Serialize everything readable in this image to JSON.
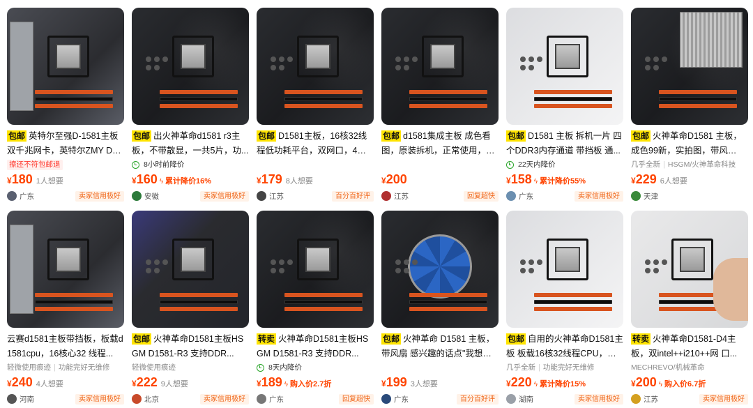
{
  "listings": [
    {
      "post": "包邮",
      "title": "英特尔至强D-1581主板双千兆网卡，英特尔ZMY D150...",
      "tag": {
        "type": "red",
        "text": "擦还不符包邮退"
      },
      "price": "180",
      "want": "1人想要",
      "drop": "",
      "city": "广东",
      "credit": "卖家信用极好",
      "avatar_color": "#5a6070",
      "img": "io"
    },
    {
      "post": "包邮",
      "title": "出火神革命d1581 r3主板，不带散显，一共5片，功...",
      "tag": {
        "type": "time",
        "text": "8小时前降价"
      },
      "price": "160",
      "want": "",
      "drop": "累计降价16%",
      "city": "安徽",
      "credit": "卖家信用极好",
      "avatar_color": "#2c7a3a",
      "img": "board"
    },
    {
      "post": "包邮",
      "title": "D1581主板，16核32线程低功耗平台，双网口，4个US...",
      "tag": null,
      "price": "179",
      "want": "8人想要",
      "drop": "",
      "city": "江苏",
      "credit": "百分百好评",
      "avatar_color": "#444444",
      "img": "board"
    },
    {
      "post": "包邮",
      "title": "d1581集成主板 成色看图，原装拆机，正常使用，有...",
      "tag": null,
      "price": "200",
      "want": "",
      "drop": "",
      "city": "江苏",
      "credit": "回复超快",
      "avatar_color": "#b03030",
      "img": "board"
    },
    {
      "post": "包邮",
      "title": "D1581 主板 拆机一片 四个DDR3内存通道 带挡板 通...",
      "tag": {
        "type": "time",
        "text": "22天内降价"
      },
      "price": "158",
      "want": "",
      "drop": "累计降价55%",
      "city": "广东",
      "credit": "卖家信用极好",
      "avatar_color": "#6b8fb0",
      "img": "white"
    },
    {
      "post": "包邮",
      "title": "火神革命D1581 主板，成色99新，实拍图，带风扇，...",
      "tag": {
        "type": "gray",
        "text": "几乎全新",
        "text2": "HSGM/火神革命科技"
      },
      "price": "229",
      "want": "6人想要",
      "drop": "",
      "city": "天津",
      "credit": "",
      "avatar_color": "#3a8a3a",
      "img": "heatsink"
    },
    {
      "post": "",
      "title": "云赛d1581主板带挡板，板载d1581cpu，16核心32 线程...",
      "tag": {
        "type": "gray",
        "text": "轻微使用痕迹",
        "text2": "功能完好无维修"
      },
      "price": "240",
      "want": "4人想要",
      "drop": "",
      "city": "河南",
      "credit": "卖家信用极好",
      "avatar_color": "#555555",
      "img": "io"
    },
    {
      "post": "包邮",
      "title": "火神革命D1581主板HSGM D1581-R3 支持DDR...",
      "tag": {
        "type": "gray",
        "text": "轻微使用痕迹"
      },
      "price": "222",
      "want": "9人想要",
      "drop": "",
      "city": "北京",
      "credit": "卖家信用极好",
      "avatar_color": "#c84a2a",
      "img": "purple"
    },
    {
      "post": "转卖",
      "title": "火神革命D1581主板HSGM D1581-R3 支持DDR...",
      "tag": {
        "type": "time",
        "text": "8天内降价"
      },
      "price": "189",
      "want": "",
      "drop": "购入价2.7折",
      "city": "广东",
      "credit": "回复超快",
      "avatar_color": "#777777",
      "img": "board"
    },
    {
      "post": "包邮",
      "title": "火神革命 D1581 主板，带风扇 感兴趣的话点\"我想要\"...",
      "tag": null,
      "price": "199",
      "want": "3人想要",
      "drop": "",
      "city": "广东",
      "credit": "百分百好评",
      "avatar_color": "#2a4a7a",
      "img": "fan"
    },
    {
      "post": "包邮",
      "title": "自用的火神革命D1581主板 板载16核32线程CPU，功...",
      "tag": {
        "type": "gray",
        "text": "几乎全新",
        "text2": "功能完好无维修"
      },
      "price": "220",
      "want": "",
      "drop": "累计降价15%",
      "city": "湖南",
      "credit": "卖家信用极好",
      "avatar_color": "#9aa0a8",
      "img": "white"
    },
    {
      "post": "转卖",
      "title": "火神革命D1581-D4主板，双intel++i210++网 口...",
      "tag": {
        "type": "gray",
        "text": "MECHREVO/机械革命"
      },
      "price": "200",
      "want": "",
      "drop": "购入价6.7折",
      "city": "江苏",
      "credit": "卖家信用极好",
      "avatar_color": "#d4a020",
      "img": "hand"
    }
  ]
}
